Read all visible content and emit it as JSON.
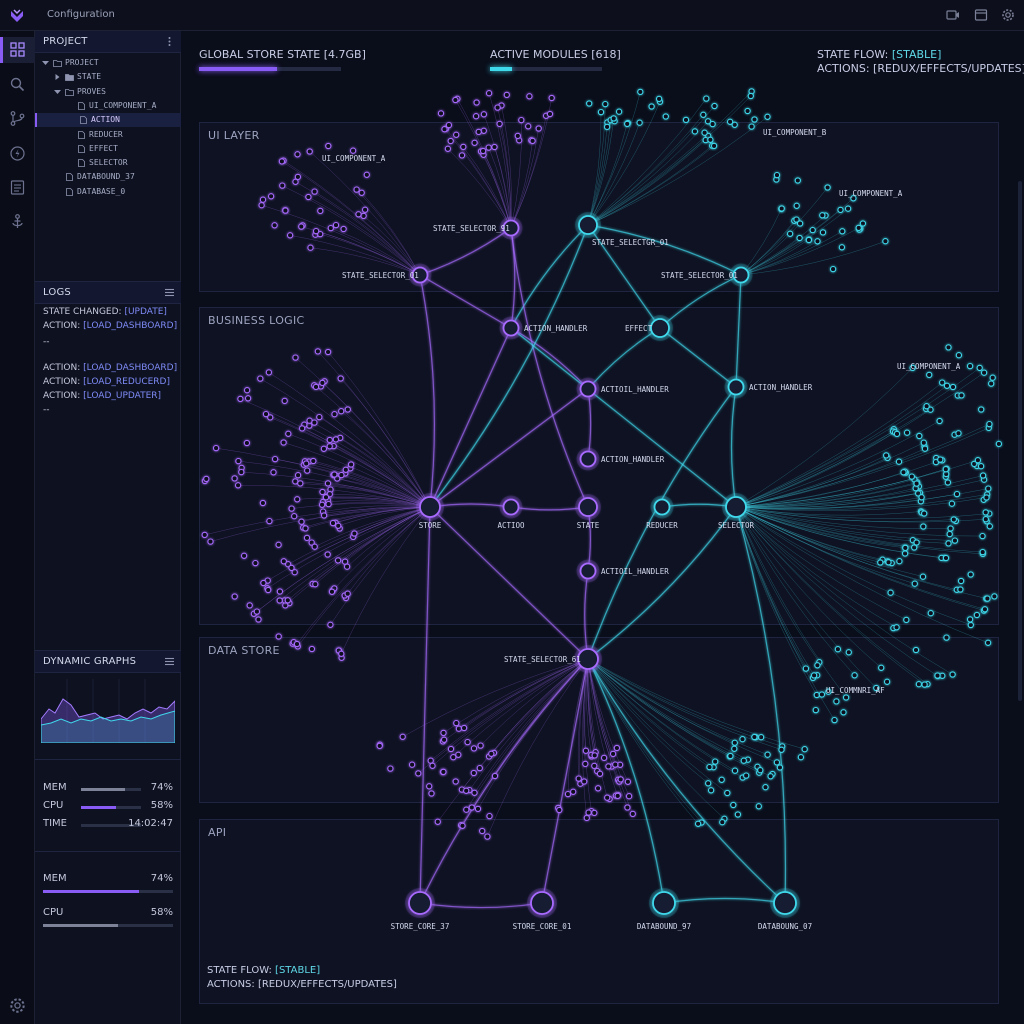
{
  "window": {
    "title": "Configuration"
  },
  "sidebar": {
    "project": {
      "header": "PROJECT",
      "tree": [
        {
          "label": "PROJECT",
          "indent": 0,
          "kind": "folder-open"
        },
        {
          "label": "STATE",
          "indent": 1,
          "kind": "folder"
        },
        {
          "label": "PROVES",
          "indent": 1,
          "kind": "folder-open"
        },
        {
          "label": "UI_COMPONENT_A",
          "indent": 2,
          "kind": "file"
        },
        {
          "label": "ACTION",
          "indent": 2,
          "kind": "file",
          "selected": true
        },
        {
          "label": "REDUCER",
          "indent": 2,
          "kind": "file"
        },
        {
          "label": "EFFECT",
          "indent": 2,
          "kind": "file"
        },
        {
          "label": "SELECTOR",
          "indent": 2,
          "kind": "file"
        },
        {
          "label": "DATABOUND_37",
          "indent": 1,
          "kind": "file"
        },
        {
          "label": "DATABASE_0",
          "indent": 1,
          "kind": "file"
        }
      ]
    },
    "logs": {
      "header": "LOGS",
      "lines": [
        {
          "pre": "STATE CHANGED: ",
          "hl": "[UPDATE]"
        },
        {
          "pre": "ACTION: ",
          "hl": "[LOAD_DASHBOARD]"
        },
        {
          "pre": "--",
          "hl": ""
        },
        {
          "pre": "ACTION: ",
          "hl": "[LOAD_DASHBOARD]"
        },
        {
          "pre": "ACTION: ",
          "hl": "[LOAD_REDUCERD]"
        },
        {
          "pre": "ACTION: ",
          "hl": "[LOAD_UPDATER]"
        },
        {
          "pre": "--",
          "hl": ""
        }
      ]
    },
    "graphs": {
      "header": "DYNAMIC GRAPHS",
      "stats": [
        {
          "label": "MEM",
          "value": "74%",
          "level": 0.74
        },
        {
          "label": "CPU",
          "value": "58%",
          "level": 0.58
        },
        {
          "label": "TIME",
          "value": "14:02:47",
          "level": 0
        }
      ],
      "summary": [
        {
          "label": "MEM",
          "value": "74%",
          "level": 0.74
        },
        {
          "label": "CPU",
          "value": "58%",
          "level": 0.58
        }
      ]
    }
  },
  "hud": {
    "store": {
      "label": "GLOBAL STORE STATE ",
      "value": "[4.7GB]",
      "level": 0.55
    },
    "modules": {
      "label": "ACTIVE MODULES ",
      "value": "[618]",
      "level": 0.2
    },
    "flow": {
      "label": "STATE FLOW: ",
      "value": "[STABLE]"
    },
    "actions": {
      "text": "ACTIONS: [REDUX/EFFECTS/UPDATES]"
    }
  },
  "layers": [
    "UI LAYER",
    "BUSINESS LOGIC",
    "DATA STORE",
    "API"
  ],
  "footer": {
    "flow_label": "STATE FLOW: ",
    "flow_value": "[STABLE]",
    "actions": "ACTIONS: [REDUX/EFFECTS/UPDATES]"
  },
  "graph": {
    "nodes": [
      {
        "id": "n_ss01",
        "label": "STATE_SELECTOR_01",
        "tone": "violet"
      },
      {
        "id": "n_ss91",
        "label": "STATE_SELECTOR_91",
        "tone": "violet"
      },
      {
        "id": "n_ssgr",
        "label": "STATE_SELECTGR_01",
        "tone": "cyan"
      },
      {
        "id": "n_ss01b",
        "label": "STATE_SELECTOR_01",
        "tone": "cyan"
      },
      {
        "id": "n_ah1",
        "label": "ACTION_HANDLER",
        "tone": "violet"
      },
      {
        "id": "n_eff",
        "label": "EFFECT",
        "tone": "cyan"
      },
      {
        "id": "n_ah2",
        "label": "ACTIOIL_HANDLER",
        "tone": "violet"
      },
      {
        "id": "n_ah3",
        "label": "ACTION_HANDLER",
        "tone": "cyan"
      },
      {
        "id": "n_ah4",
        "label": "ACTION_HANDLER",
        "tone": "violet"
      },
      {
        "id": "n_store",
        "label": "STORE",
        "tone": "violet"
      },
      {
        "id": "n_action",
        "label": "ACTIOO",
        "tone": "violet"
      },
      {
        "id": "n_state",
        "label": "STATE",
        "tone": "violet"
      },
      {
        "id": "n_reducer",
        "label": "REDUCER",
        "tone": "cyan"
      },
      {
        "id": "n_selector",
        "label": "SELECTOR",
        "tone": "cyan"
      },
      {
        "id": "n_ah5",
        "label": "ACTIOIL_HANDLER",
        "tone": "violet"
      },
      {
        "id": "n_ss61",
        "label": "STATE_SELECTOR_61",
        "tone": "violet"
      },
      {
        "id": "n_sc37",
        "label": "STORE_CORE_37",
        "tone": "violet"
      },
      {
        "id": "n_sc01",
        "label": "STORE_CORE_01",
        "tone": "violet"
      },
      {
        "id": "n_db97",
        "label": "DATABOUND_97",
        "tone": "cyan"
      },
      {
        "id": "n_db07",
        "label": "DATABOUNG_07",
        "tone": "cyan"
      }
    ],
    "cluster_labels": [
      {
        "id": "c_uia1",
        "label": "UI_COMPONENT_A"
      },
      {
        "id": "c_uib",
        "label": "UI_COMPONENT_B"
      },
      {
        "id": "c_uia2",
        "label": "UI_COMPONENT_A"
      },
      {
        "id": "c_uia3",
        "label": "UI_COMPONENT_A"
      },
      {
        "id": "c_uiaf",
        "label": "UI_COMMNRI_AF"
      }
    ],
    "colors": {
      "violet": "#a86bff",
      "cyan": "#3fd9ec",
      "accent": "#8a5cf6"
    }
  }
}
